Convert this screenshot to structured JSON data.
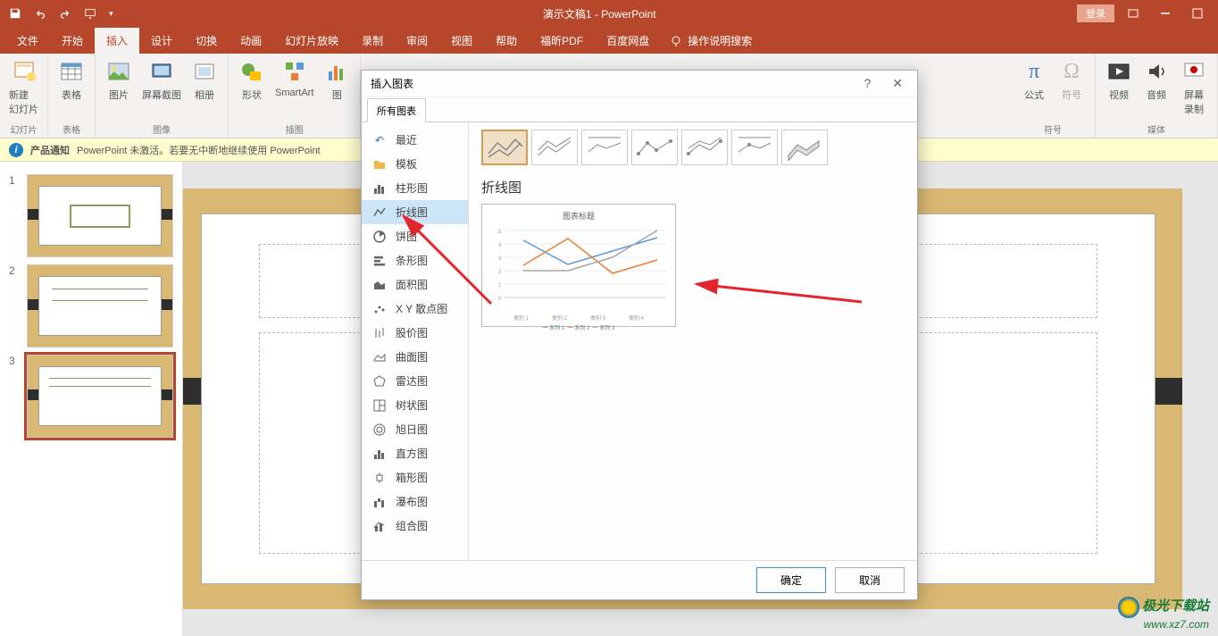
{
  "app": {
    "title": "演示文稿1 - PowerPoint",
    "login": "登录"
  },
  "tabs": {
    "file": "文件",
    "home": "开始",
    "insert": "插入",
    "design": "设计",
    "trans": "切换",
    "anim": "动画",
    "slideshow": "幻灯片放映",
    "record": "录制",
    "review": "审阅",
    "view": "视图",
    "help": "帮助",
    "foxit": "福昕PDF",
    "baidu": "百度网盘",
    "tellme": "操作说明搜索"
  },
  "ribbon": {
    "newslide": "新建\n幻灯片",
    "table": "表格",
    "picture": "图片",
    "screenshot": "屏幕截图",
    "album": "相册",
    "shapes": "形状",
    "smartart": "SmartArt",
    "chart": "图",
    "equation": "公式",
    "symbol": "符号",
    "video": "视频",
    "audio": "音频",
    "screenrec": "屏幕\n录制",
    "g_slides": "幻灯片",
    "g_tables": "表格",
    "g_images": "图像",
    "g_illus": "插图",
    "g_symbols": "符号",
    "g_media": "媒体"
  },
  "notify": {
    "label": "产品通知",
    "text": "PowerPoint 未激活。若要无中断地继续使用 PowerPoint"
  },
  "slides": {
    "n1": "1",
    "n2": "2",
    "n3": "3"
  },
  "dialog": {
    "title": "插入图表",
    "tab": "所有图表",
    "cats": {
      "recent": "最近",
      "template": "模板",
      "column": "柱形图",
      "line": "折线图",
      "pie": "饼图",
      "bar": "条形图",
      "area": "面积图",
      "xy": "X Y 散点图",
      "stock": "股价图",
      "surface": "曲面图",
      "radar": "雷达图",
      "treemap": "树状图",
      "sunburst": "旭日图",
      "histogram": "直方图",
      "boxwhisker": "箱形图",
      "waterfall": "瀑布图",
      "combo": "组合图"
    },
    "chart_label": "折线图",
    "preview": {
      "title": "图表标题",
      "leg1": "系列 1",
      "leg2": "系列 2",
      "leg3": "系列 3",
      "c1": "类别 1",
      "c2": "类别 2",
      "c3": "类别 3",
      "c4": "类别 4"
    },
    "ok": "确定",
    "cancel": "取消"
  },
  "watermark": {
    "name": "极光下载站",
    "url": "www.xz7.com"
  },
  "chart_data": {
    "type": "line",
    "title": "图表标题",
    "categories": [
      "类别 1",
      "类别 2",
      "类别 3",
      "类别 4"
    ],
    "series": [
      {
        "name": "系列 1",
        "values": [
          4.3,
          2.5,
          3.5,
          4.5
        ]
      },
      {
        "name": "系列 2",
        "values": [
          2.4,
          4.4,
          1.8,
          2.8
        ]
      },
      {
        "name": "系列 3",
        "values": [
          2.0,
          2.0,
          3.0,
          5.0
        ]
      }
    ],
    "ylim": [
      0,
      6
    ]
  }
}
